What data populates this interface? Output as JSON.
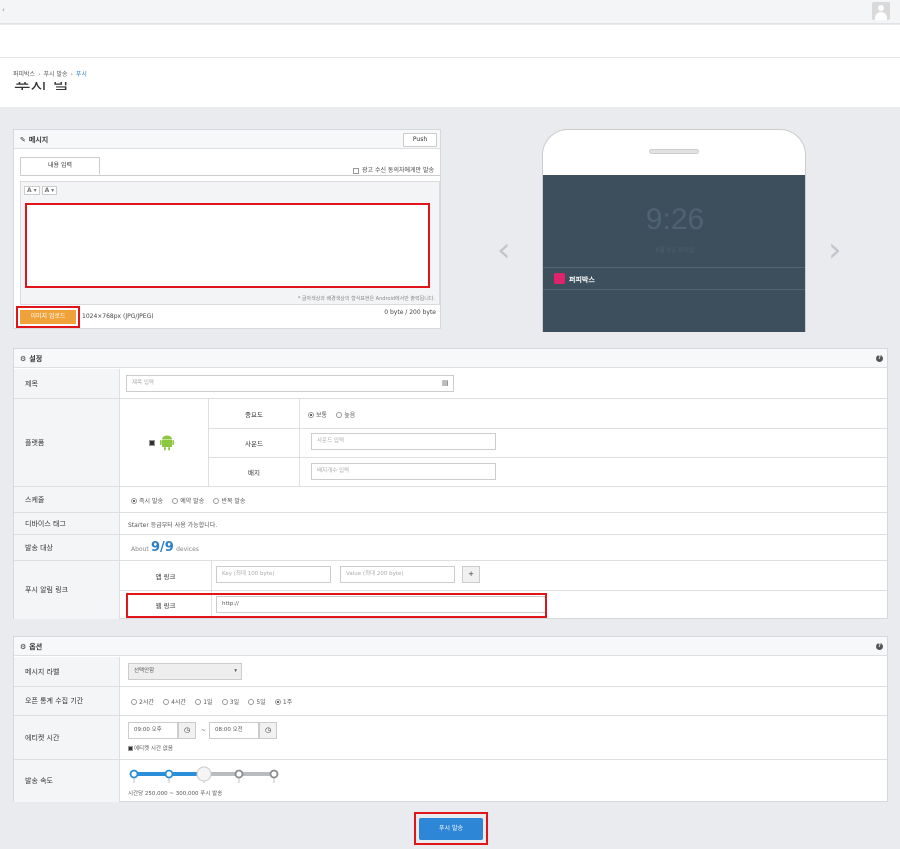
{
  "breadcrumb": {
    "items": [
      "퍼피박스",
      "푸시 발송",
      "푸시"
    ]
  },
  "page_title": "푸시 발송",
  "message": {
    "heading": "메시지",
    "push_button": "Push",
    "tab_content": "내용 입력",
    "consent_label": "광고 수신 동의자에게만 발송",
    "font_tool": "A",
    "bg_tool": "A",
    "editor_note": "* 글자색상과 배경색상의 형식표현은 Android에서만 출력됩니다.",
    "upload_button": "이미지 업로드",
    "image_spec": "1024×768px (JPG/JPEG)",
    "byte_count": "0 byte / 200 byte"
  },
  "preview": {
    "time": "9:26",
    "date": "6월 9일 화요일",
    "app_name": "퍼피박스",
    "app_color": "#e0246c"
  },
  "settings": {
    "heading": "설정",
    "title_label": "제목",
    "title_placeholder": "제목 입력",
    "platform_label": "플랫폼",
    "importance_label": "중요도",
    "importance_normal": "보통",
    "importance_high": "높음",
    "sound_label": "사운드",
    "sound_placeholder": "사운드 입력",
    "badge_label": "배지",
    "badge_placeholder": "배지개수 입력",
    "schedule_label": "스케줄",
    "schedule_now": "즉시 발송",
    "schedule_reserve": "예약 발송",
    "schedule_repeat": "반복 발송",
    "device_tag_label": "디바이스 태그",
    "device_tag_note": "Starter 등급부터 사용 가능합니다.",
    "target_label": "발송 대상",
    "target_about": "About",
    "target_count": "9/9",
    "target_unit": "devices",
    "link_label": "푸시 알림 링크",
    "app_link_label": "앱 링크",
    "key_placeholder": "Key (최대 100 byte)",
    "value_placeholder": "Value (최대 200 byte)",
    "plus": "+",
    "web_link_label": "웹 링크",
    "web_link_value": "http://"
  },
  "options": {
    "heading": "옵션",
    "label_label": "메시지 라벨",
    "label_select": "선택안함",
    "stats_label": "오픈 통계 수집 기간",
    "stats_options": [
      "2시간",
      "4시간",
      "1일",
      "3일",
      "5일",
      "1주"
    ],
    "etiquette_label": "에티켓 시간",
    "etiquette_start": "09:00 오후",
    "etiquette_sep": "~",
    "etiquette_end": "08:00 오전",
    "etiquette_check": "에티켓 시간 없음",
    "speed_label": "발송 속도",
    "speed_level": 0.5,
    "speed_note": "시간당 250,000 ~ 300,000 푸시 발송"
  },
  "send_button": "푸시 발송",
  "colors": {
    "accent": "#2e86d6",
    "upload": "#f0a23a",
    "highlight": "#e0141b"
  }
}
